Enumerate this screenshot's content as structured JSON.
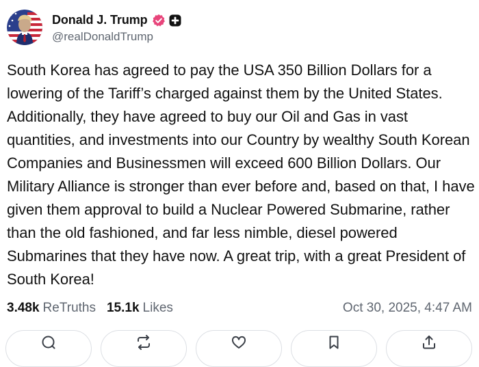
{
  "author": {
    "display_name": "Donald J. Trump",
    "handle": "@realDonaldTrump",
    "avatar_icon": "flag-portrait-avatar",
    "verified_icon": "verified-badge-icon",
    "plus_icon": "plus-badge-icon"
  },
  "post": {
    "text": "South Korea has agreed to pay the USA 350 Billion Dollars for a lowering of the Tariff’s charged against them by the United States. Additionally, they have agreed to buy our Oil and Gas in vast quantities, and investments into our Country by wealthy South Korean Companies and Businessmen will exceed 600 Billion Dollars. Our Military Alliance is stronger than ever before and, based on that, I have given them approval to build a Nuclear Powered Submarine, rather than the old fashioned, and far less nimble, diesel powered Submarines that they have now. A great trip, with a great President of South Korea!"
  },
  "stats": {
    "retruths_count": "3.48k",
    "retruths_label": "ReTruths",
    "likes_count": "15.1k",
    "likes_label": "Likes",
    "timestamp": "Oct 30, 2025, 4:47 AM"
  },
  "actions": [
    {
      "icon": "reply-icon"
    },
    {
      "icon": "retruth-icon"
    },
    {
      "icon": "like-icon"
    },
    {
      "icon": "bookmark-icon"
    },
    {
      "icon": "share-icon"
    }
  ],
  "colors": {
    "verified": "#e8457b",
    "muted_text": "#5f6670",
    "button_border": "#dcdfe4"
  }
}
